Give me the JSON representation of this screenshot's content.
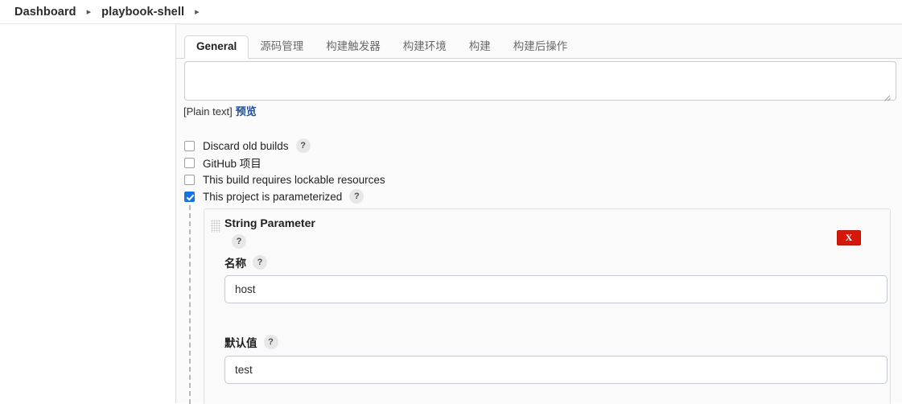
{
  "breadcrumb": {
    "items": [
      {
        "label": "Dashboard"
      },
      {
        "label": "playbook-shell"
      }
    ],
    "separator": "▸"
  },
  "tabs": [
    {
      "label": "General",
      "active": true
    },
    {
      "label": "源码管理",
      "active": false
    },
    {
      "label": "构建触发器",
      "active": false
    },
    {
      "label": "构建环境",
      "active": false
    },
    {
      "label": "构建",
      "active": false
    },
    {
      "label": "构建后操作",
      "active": false
    }
  ],
  "description": {
    "value": "",
    "placeholder": "",
    "markup_note": "[Plain text]",
    "preview_link": "预览"
  },
  "options": [
    {
      "label": "Discard old builds",
      "checked": false,
      "help": "?"
    },
    {
      "label": "GitHub 项目",
      "checked": false,
      "help": ""
    },
    {
      "label": "This build requires lockable resources",
      "checked": false,
      "help": ""
    },
    {
      "label": "This project is parameterized",
      "checked": true,
      "help": "?"
    }
  ],
  "parameter": {
    "title": "String Parameter",
    "title_help": "?",
    "delete_label": "X",
    "name_field": {
      "label": "名称",
      "help": "?",
      "value": "host",
      "placeholder": ""
    },
    "default_field": {
      "label": "默认值",
      "help": "?",
      "value": "test",
      "placeholder": ""
    }
  },
  "colors": {
    "accent_blue": "#1474e6",
    "link_blue": "#1a4fa0",
    "danger_red": "#d5180b",
    "panel_bg": "#fafafa"
  }
}
